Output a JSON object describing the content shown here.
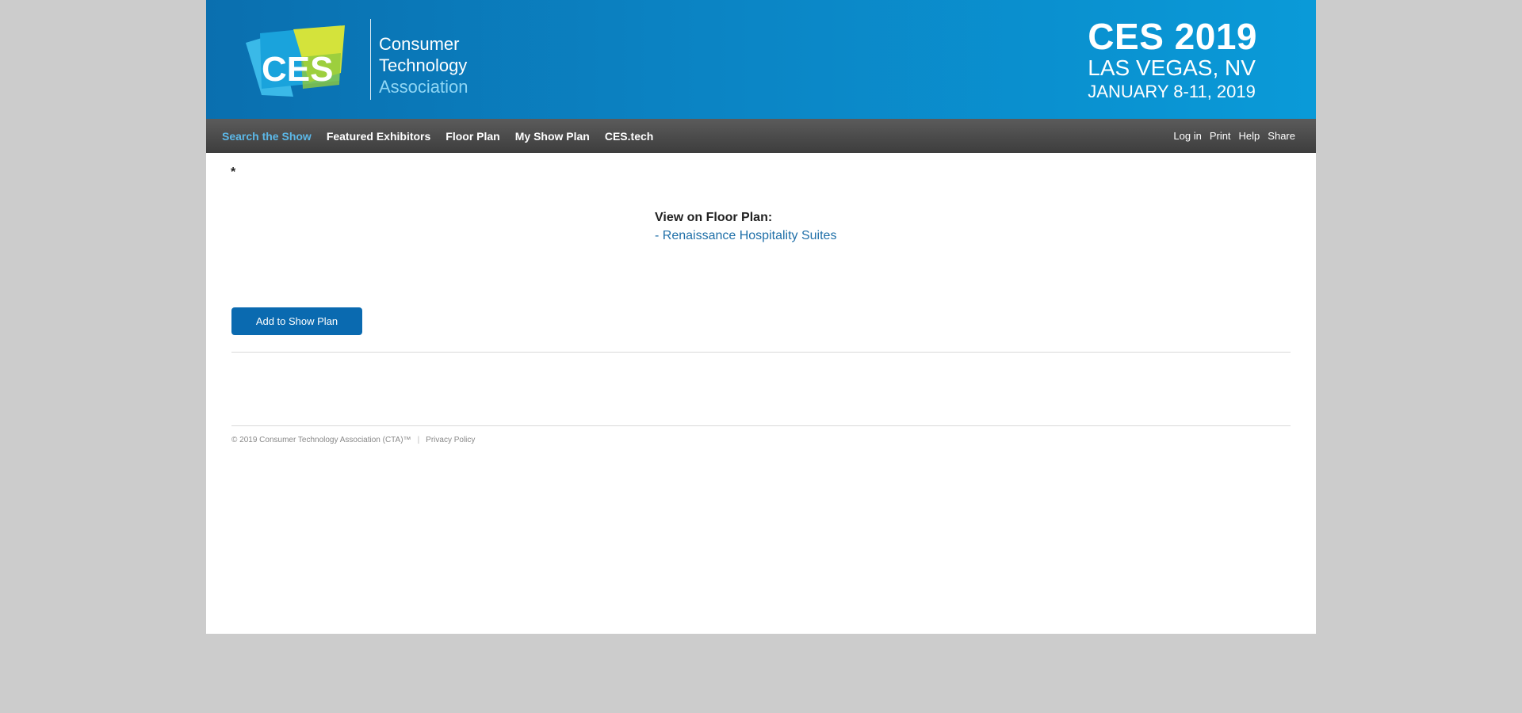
{
  "header": {
    "logo": {
      "mark_text": "CES",
      "org_line1": "Consumer",
      "org_line2": "Technology",
      "org_line3": "Association"
    },
    "event": {
      "title": "CES 2019",
      "location": "LAS VEGAS, NV",
      "dates": "JANUARY 8-11, 2019"
    },
    "colors": {
      "banner": "#0b84c4",
      "accent_light": "#5cb8e8",
      "logo_yellow": "#d4e33b",
      "logo_cyan": "#34c5ef"
    }
  },
  "nav": {
    "items": [
      {
        "label": "Search the Show",
        "active": true
      },
      {
        "label": "Featured Exhibitors"
      },
      {
        "label": "Floor Plan"
      },
      {
        "label": "My Show Plan"
      },
      {
        "label": "CES.tech"
      }
    ],
    "utilities": [
      "Log in",
      "Print",
      "Help",
      "Share"
    ]
  },
  "main": {
    "asterisk": "*",
    "floorplan_label": "View on Floor Plan:",
    "floorplan_link": "- Renaissance Hospitality Suites",
    "add_button": "Add to Show Plan",
    "button_color": "#0a6ab0"
  },
  "footer": {
    "copyright": "© 2019 Consumer Technology Association (CTA)™",
    "separator": "|",
    "privacy": "Privacy Policy"
  }
}
